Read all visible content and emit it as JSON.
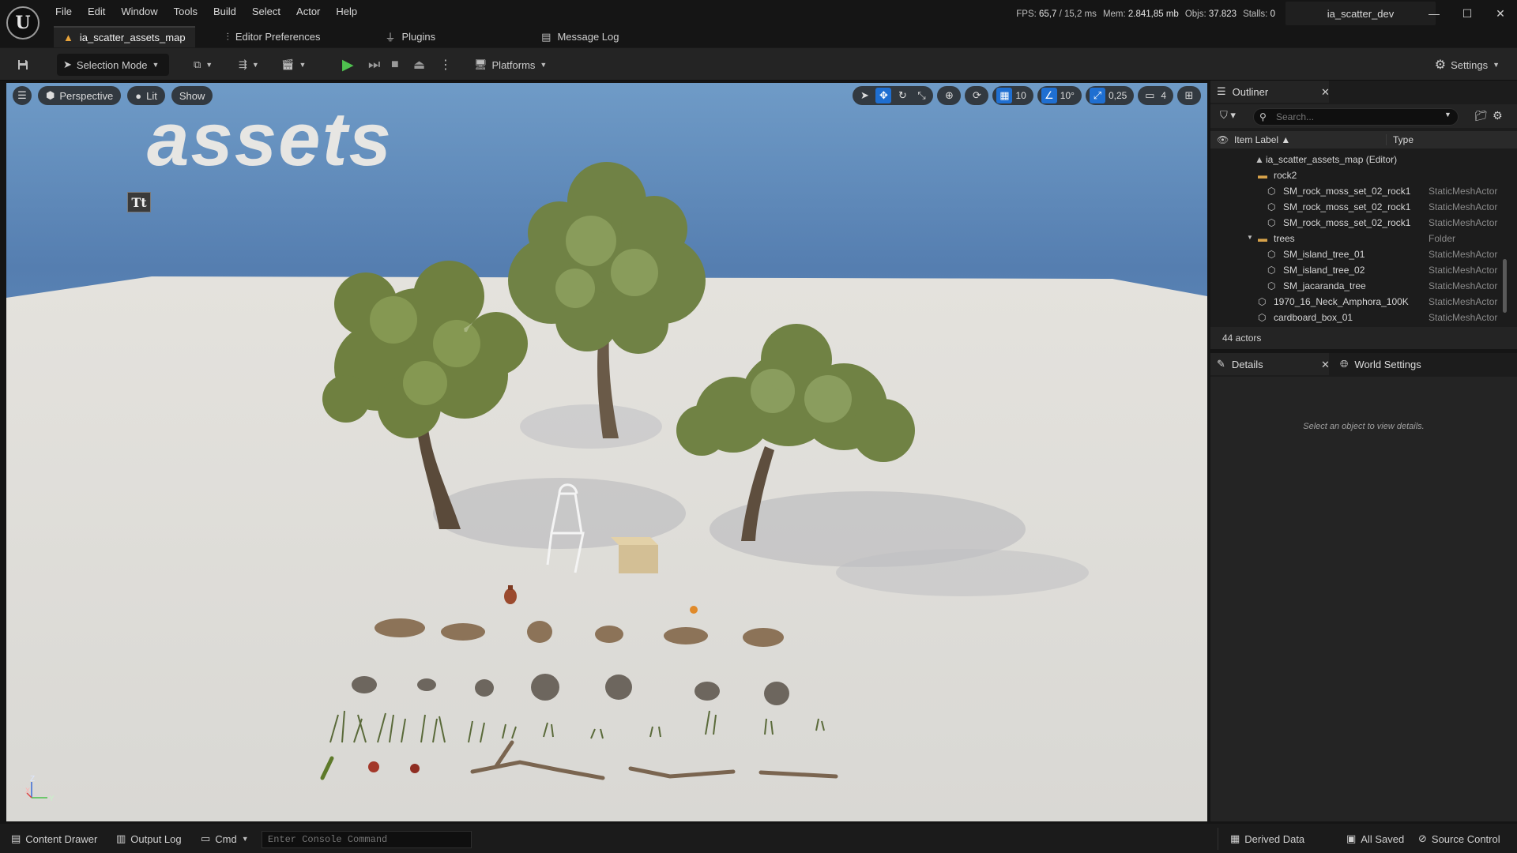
{
  "app": {
    "logo_letter": "U",
    "menu": [
      "File",
      "Edit",
      "Window",
      "Tools",
      "Build",
      "Select",
      "Actor",
      "Help"
    ],
    "tabs": [
      {
        "label": "ia_scatter_assets_map",
        "icon": "level-icon",
        "active": true
      },
      {
        "label": "Editor Preferences",
        "icon": "sliders-icon",
        "active": false
      },
      {
        "label": "Plugins",
        "icon": "plug-icon",
        "active": false
      },
      {
        "label": "Message Log",
        "icon": "log-icon",
        "active": false
      }
    ],
    "stats": {
      "fps_label": "FPS:",
      "fps": "65,7",
      "ms": "/ 15,2 ms",
      "mem_label": "Mem:",
      "mem": "2.841,85 mb",
      "objs_label": "Objs:",
      "objs": "37.823",
      "stalls_label": "Stalls:",
      "stalls": "0"
    },
    "project_name": "ia_scatter_dev"
  },
  "toolbar": {
    "selection_mode": "Selection Mode",
    "platforms": "Platforms",
    "settings": "Settings"
  },
  "viewport": {
    "perspective": "Perspective",
    "lit": "Lit",
    "show": "Show",
    "grid_snap": "10",
    "rotation_snap": "10°",
    "scale_snap": "0,25",
    "camera_speed": "4",
    "scene_text": "assets",
    "text_actor_glyph": "Tt",
    "axis": {
      "z": "Z",
      "x": "X",
      "y": "Y"
    }
  },
  "outliner": {
    "title": "Outliner",
    "search_placeholder": "Search...",
    "col_label": "Item Label ▲",
    "col_type": "Type",
    "rows": [
      {
        "name": "ia_scatter_assets_map (Editor)",
        "type": "",
        "indent": 0,
        "kind": "map"
      },
      {
        "name": "rock2",
        "type": "",
        "indent": 1,
        "kind": "folder"
      },
      {
        "name": "SM_rock_moss_set_02_rock1",
        "type": "StaticMeshActor",
        "indent": 2,
        "kind": "mesh"
      },
      {
        "name": "SM_rock_moss_set_02_rock1",
        "type": "StaticMeshActor",
        "indent": 2,
        "kind": "mesh"
      },
      {
        "name": "SM_rock_moss_set_02_rock1",
        "type": "StaticMeshActor",
        "indent": 2,
        "kind": "mesh"
      },
      {
        "name": "trees",
        "type": "Folder",
        "indent": 1,
        "kind": "folder-open"
      },
      {
        "name": "SM_island_tree_01",
        "type": "StaticMeshActor",
        "indent": 2,
        "kind": "mesh"
      },
      {
        "name": "SM_island_tree_02",
        "type": "StaticMeshActor",
        "indent": 2,
        "kind": "mesh"
      },
      {
        "name": "SM_jacaranda_tree",
        "type": "StaticMeshActor",
        "indent": 2,
        "kind": "mesh"
      },
      {
        "name": "1970_16_Neck_Amphora_100K",
        "type": "StaticMeshActor",
        "indent": 1,
        "kind": "mesh"
      },
      {
        "name": "cardboard_box_01",
        "type": "StaticMeshActor",
        "indent": 1,
        "kind": "mesh"
      }
    ],
    "actor_count": "44 actors"
  },
  "details": {
    "title": "Details",
    "world_settings": "World Settings",
    "empty_message": "Select an object to view details."
  },
  "statusbar": {
    "content_drawer": "Content Drawer",
    "output_log": "Output Log",
    "cmd": "Cmd",
    "console_placeholder": "Enter Console Command",
    "derived_data": "Derived Data",
    "all_saved": "All Saved",
    "source_control": "Source Control"
  },
  "colors": {
    "accent_blue": "#1f6fd1",
    "play_green": "#4fc24f",
    "folder_gold": "#d7a24a",
    "level_orange": "#e8a33a"
  }
}
